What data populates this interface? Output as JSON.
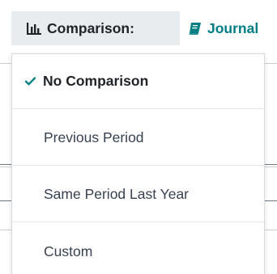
{
  "toolbar": {
    "comparison_label": "Comparison:",
    "comparison_icon": "bar-chart-icon",
    "journal_label": "Journal",
    "journal_icon": "book-icon"
  },
  "comparison_menu": {
    "items": [
      {
        "label": "No Comparison",
        "selected": true
      },
      {
        "label": "Previous Period",
        "selected": false
      },
      {
        "label": "Same Period Last Year",
        "selected": false
      },
      {
        "label": "Custom",
        "selected": false
      }
    ]
  },
  "colors": {
    "accent_teal": "#017e84",
    "button_bg": "#e9ecef",
    "text_dark": "#212529",
    "text_item": "#374151"
  }
}
